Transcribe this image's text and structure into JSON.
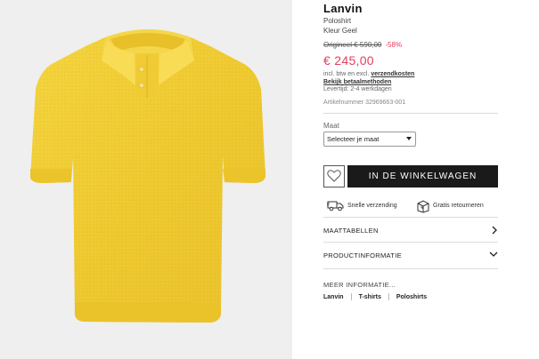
{
  "product": {
    "brand": "Lanvin",
    "name": "Poloshirt",
    "color": "Kleur Geel",
    "original_price": "Origineel € 590,00",
    "discount": "-58%",
    "price": "€ 245,00",
    "tax_text": "incl. btw en excl. ",
    "shipping_link": "verzendkosten",
    "payment_link": "Bekijk betaalmethoden",
    "delivery": "Levertijd: 2-4 werkdagen",
    "article_number": "Artikelnummer 32969663-001",
    "image_color": "#f2cf3b"
  },
  "size": {
    "label": "Maat",
    "select_value": "Selecteer je maat"
  },
  "actions": {
    "cart_button": "IN DE WINKELWAGEN"
  },
  "perks": {
    "shipping": "Snelle verzending",
    "returns": "Gratis retourneren"
  },
  "accordions": [
    {
      "label": "MAATTABELLEN",
      "icon": "chevron-right-icon"
    },
    {
      "label": "PRODUCTINFORMATIE",
      "icon": "chevron-down-icon"
    }
  ],
  "more_info": {
    "title": "MEER INFORMATIE...",
    "tags": [
      "Lanvin",
      "T-shirts",
      "Poloshirts"
    ]
  },
  "colors": {
    "accent": "#e0405e",
    "button_bg": "#1a1a1a",
    "panel_bg": "#efefef"
  }
}
